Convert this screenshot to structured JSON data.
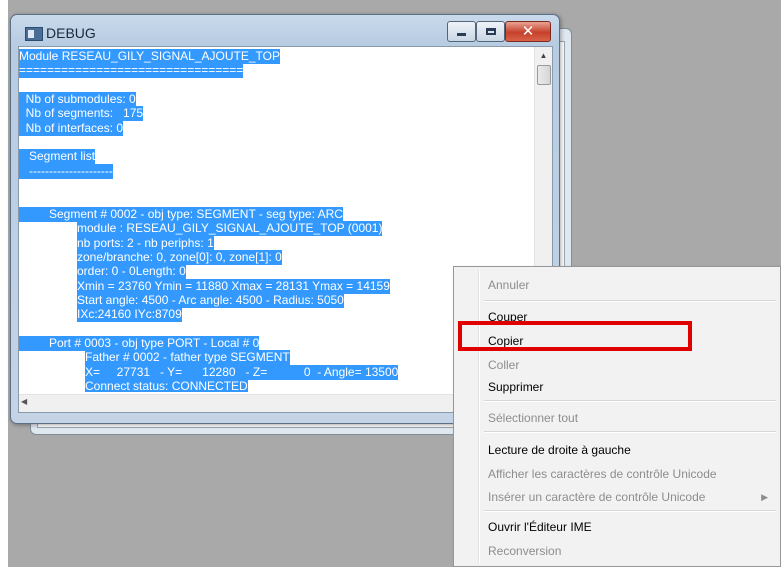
{
  "window": {
    "title": "DEBUG"
  },
  "debug_lines": [
    {
      "text": "Module RESEAU_GILY_SIGNAL_AJOUTE_TOP",
      "indent": 0
    },
    {
      "text": "================================",
      "indent": 0
    },
    {
      "text": "",
      "indent": 0
    },
    {
      "text": "  Nb of submodules: 0",
      "indent": 0
    },
    {
      "text": "  Nb of segments:   175",
      "indent": 0
    },
    {
      "text": "  Nb of interfaces: 0",
      "indent": 0
    },
    {
      "text": "",
      "indent": 0
    },
    {
      "text": "   Segment list",
      "indent": 0
    },
    {
      "text": "   ---------------------",
      "indent": 0
    },
    {
      "text": "",
      "indent": 0
    },
    {
      "text": "",
      "indent": 0
    },
    {
      "text": "         Segment # 0002 - obj type: SEGMENT - seg type: ARC",
      "indent": 0
    },
    {
      "text": "module : RESEAU_GILY_SIGNAL_AJOUTE_TOP (0001)",
      "indent": 1
    },
    {
      "text": "nb ports: 2 - nb periphs: 1",
      "indent": 1
    },
    {
      "text": "zone/branche: 0, zone[0]: 0, zone[1]: 0",
      "indent": 1
    },
    {
      "text": "order: 0 - 0Length: 0",
      "indent": 1
    },
    {
      "text": "Xmin = 23760 Ymin = 11880 Xmax = 28131 Ymax = 14159",
      "indent": 1
    },
    {
      "text": "Start angle: 4500 - Arc angle: 4500 - Radius: 5050",
      "indent": 1
    },
    {
      "text": "IXc:24160 IYc:8709",
      "indent": 1
    },
    {
      "text": "",
      "indent": 0
    },
    {
      "text": "         Port # 0003 - obj type PORT - Local # 0",
      "indent": 0
    },
    {
      "text": "Father # 0002 - father type SEGMENT",
      "indent": 2
    },
    {
      "text": "X=     27731   - Y=      12280   - Z=           0  - Angle= 13500",
      "indent": 2
    },
    {
      "text": "Connect status: CONNECTED",
      "indent": 2
    }
  ],
  "context_menu": {
    "items": [
      {
        "label": "Annuler",
        "enabled": false
      },
      {
        "separator": true
      },
      {
        "label": "Couper",
        "enabled": true
      },
      {
        "label": "Copier",
        "enabled": true
      },
      {
        "label": "Coller",
        "enabled": false
      },
      {
        "label": "Supprimer",
        "enabled": true
      },
      {
        "separator": true
      },
      {
        "label": "Sélectionner tout",
        "enabled": false
      },
      {
        "separator": true
      },
      {
        "label": "Lecture de droite à gauche",
        "enabled": true
      },
      {
        "label": "Afficher les caractères de contrôle Unicode",
        "enabled": false
      },
      {
        "label": "Insérer un caractère de contrôle Unicode",
        "enabled": false,
        "submenu": true
      },
      {
        "separator": true
      },
      {
        "label": "Ouvrir l'Éditeur IME",
        "enabled": true
      },
      {
        "label": "Reconversion",
        "enabled": false
      }
    ]
  },
  "colors": {
    "selection": "#3399ff",
    "highlight_box": "#e00000"
  }
}
